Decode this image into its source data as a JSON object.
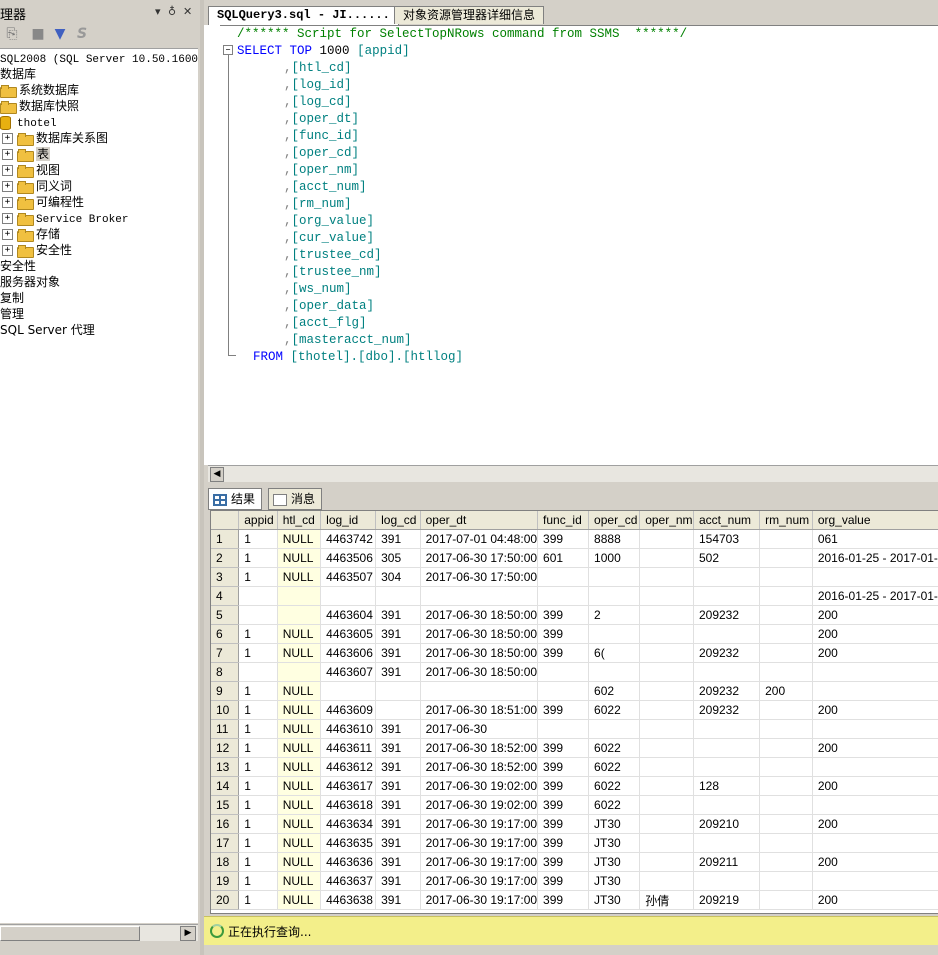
{
  "explorer": {
    "title": "理器",
    "controls": [
      "▾",
      "♁",
      "✕"
    ],
    "tree": [
      {
        "label": "SQL2008 (SQL Server 10.50.1600 -",
        "indent": 0,
        "type": "server"
      },
      {
        "label": "数据库",
        "indent": 0,
        "type": "text"
      },
      {
        "label": "系统数据库",
        "indent": 1,
        "type": "folder"
      },
      {
        "label": "数据库快照",
        "indent": 1,
        "type": "folder"
      },
      {
        "label": "thotel",
        "indent": 1,
        "type": "db"
      },
      {
        "label": "数据库关系图",
        "indent": 2,
        "type": "folder",
        "expander": "+"
      },
      {
        "label": "表",
        "indent": 2,
        "type": "folder",
        "expander": "+",
        "selected": true
      },
      {
        "label": "视图",
        "indent": 2,
        "type": "folder",
        "expander": "+"
      },
      {
        "label": "同义词",
        "indent": 2,
        "type": "folder",
        "expander": "+"
      },
      {
        "label": "可编程性",
        "indent": 2,
        "type": "folder",
        "expander": "+"
      },
      {
        "label": "Service Broker",
        "indent": 2,
        "type": "folder",
        "expander": "+"
      },
      {
        "label": "存储",
        "indent": 2,
        "type": "folder",
        "expander": "+"
      },
      {
        "label": "安全性",
        "indent": 2,
        "type": "folder",
        "expander": "+"
      },
      {
        "label": "安全性",
        "indent": 0,
        "type": "text"
      },
      {
        "label": "服务器对象",
        "indent": 0,
        "type": "text"
      },
      {
        "label": "复制",
        "indent": 0,
        "type": "text"
      },
      {
        "label": "管理",
        "indent": 0,
        "type": "text"
      },
      {
        "label": "SQL Server 代理",
        "indent": 0,
        "type": "text"
      }
    ]
  },
  "tabs": [
    {
      "label": "SQLQuery3.sql - JI......",
      "active": true
    },
    {
      "label": "对象资源管理器详细信息",
      "active": false
    }
  ],
  "editor": {
    "comment": "/****** Script for SelectTopNRows command from SSMS  ******/",
    "select_kw": "SELECT TOP",
    "top_n": "1000",
    "columns": [
      "[appid]",
      "[htl_cd]",
      "[log_id]",
      "[log_cd]",
      "[oper_dt]",
      "[func_id]",
      "[oper_cd]",
      "[oper_nm]",
      "[acct_num]",
      "[rm_num]",
      "[org_value]",
      "[cur_value]",
      "[trustee_cd]",
      "[trustee_nm]",
      "[ws_num]",
      "[oper_data]",
      "[acct_flg]",
      "[masteracct_num]"
    ],
    "from_kw": "FROM",
    "from_target": "[thotel].[dbo].[htllog]"
  },
  "results_tabs": {
    "results": "结果",
    "messages": "消息"
  },
  "grid": {
    "columns": [
      "",
      "appid",
      "htl_cd",
      "log_id",
      "log_cd",
      "oper_dt",
      "func_id",
      "oper_cd",
      "oper_nm",
      "acct_num",
      "rm_num",
      "org_value"
    ],
    "rows": [
      [
        "1",
        "1",
        "NULL",
        "4463742",
        "391",
        "2017-07-01 04:48:00",
        "399",
        "8888",
        "",
        "154703",
        "",
        "061"
      ],
      [
        "2",
        "1",
        "NULL",
        "4463506",
        "305",
        "2017-06-30 17:50:00",
        "601",
        "1000",
        "",
        "502",
        "",
        "2016-01-25 - 2017-01-"
      ],
      [
        "3",
        "1",
        "NULL",
        "4463507",
        "304",
        "2017-06-30 17:50:00",
        "",
        "",
        "",
        "",
        "",
        ""
      ],
      [
        "4",
        "",
        "",
        "",
        "",
        "",
        "",
        "",
        "",
        "",
        "",
        "2016-01-25 - 2017-01-"
      ],
      [
        "5",
        "",
        "",
        "4463604",
        "391",
        "2017-06-30 18:50:00",
        "399",
        "2",
        "",
        "209232",
        "",
        "200"
      ],
      [
        "6",
        "1",
        "NULL",
        "4463605",
        "391",
        "2017-06-30 18:50:00",
        "399",
        "",
        "",
        "",
        "",
        "200"
      ],
      [
        "7",
        "1",
        "NULL",
        "4463606",
        "391",
        "2017-06-30 18:50:00",
        "399",
        "6(",
        "",
        "209232",
        "",
        "200"
      ],
      [
        "8",
        "",
        "",
        "4463607",
        "391",
        "2017-06-30 18:50:00",
        "",
        "",
        "",
        "",
        "",
        ""
      ],
      [
        "9",
        "1",
        "NULL",
        "",
        "",
        "",
        "",
        "602",
        "",
        "209232",
        "200",
        ""
      ],
      [
        "10",
        "1",
        "NULL",
        "4463609",
        "",
        "2017-06-30 18:51:00",
        "399",
        "6022",
        "",
        "209232",
        "",
        "200"
      ],
      [
        "11",
        "1",
        "NULL",
        "4463610",
        "391",
        "2017-06-30",
        "",
        "",
        "",
        "",
        "",
        ""
      ],
      [
        "12",
        "1",
        "NULL",
        "4463611",
        "391",
        "2017-06-30 18:52:00",
        "399",
        "6022",
        "",
        "",
        "",
        "200"
      ],
      [
        "13",
        "1",
        "NULL",
        "4463612",
        "391",
        "2017-06-30 18:52:00",
        "399",
        "6022",
        "",
        "",
        "",
        ""
      ],
      [
        "14",
        "1",
        "NULL",
        "4463617",
        "391",
        "2017-06-30 19:02:00",
        "399",
        "6022",
        "",
        "128",
        "",
        "200"
      ],
      [
        "15",
        "1",
        "NULL",
        "4463618",
        "391",
        "2017-06-30 19:02:00",
        "399",
        "6022",
        "",
        "",
        "",
        ""
      ],
      [
        "16",
        "1",
        "NULL",
        "4463634",
        "391",
        "2017-06-30 19:17:00",
        "399",
        "JT30",
        "",
        "209210",
        "",
        "200"
      ],
      [
        "17",
        "1",
        "NULL",
        "4463635",
        "391",
        "2017-06-30 19:17:00",
        "399",
        "JT30",
        "",
        "",
        "",
        ""
      ],
      [
        "18",
        "1",
        "NULL",
        "4463636",
        "391",
        "2017-06-30 19:17:00",
        "399",
        "JT30",
        "",
        "209211",
        "",
        "200"
      ],
      [
        "19",
        "1",
        "NULL",
        "4463637",
        "391",
        "2017-06-30 19:17:00",
        "399",
        "JT30",
        "",
        "",
        "",
        ""
      ],
      [
        "20",
        "1",
        "NULL",
        "4463638",
        "391",
        "2017-06-30 19:17:00",
        "399",
        "JT30",
        "孙倩",
        "209219",
        "",
        "200"
      ]
    ]
  },
  "status": {
    "text": "正在执行查询..."
  }
}
